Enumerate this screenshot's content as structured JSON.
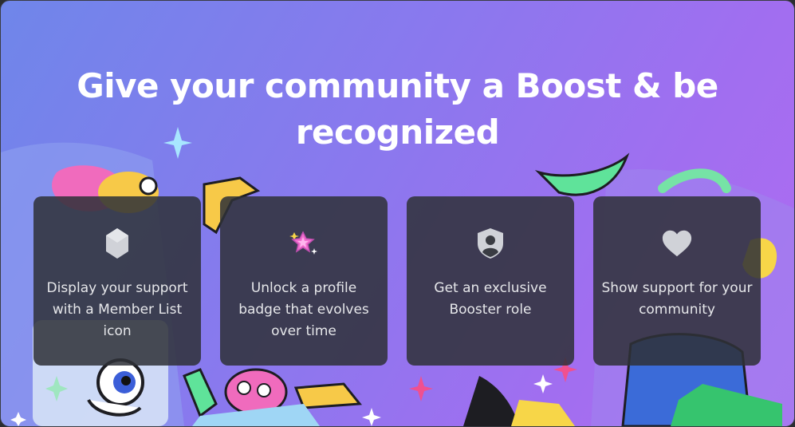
{
  "headline": "Give your community a Boost & be recognized",
  "colors": {
    "gradient_start": "#6f86ea",
    "gradient_end": "#b06bf2",
    "card_bg": "#2f3138",
    "card_text": "#e6e7ea",
    "headline": "#ffffff"
  },
  "perks": [
    {
      "icon": "hexagon-gem-icon",
      "text": "Display your support with a Member List icon"
    },
    {
      "icon": "sparkle-star-badge-icon",
      "text": "Unlock a profile badge that evolves over time"
    },
    {
      "icon": "shield-person-icon",
      "text": "Get an exclusive Booster role"
    },
    {
      "icon": "heart-icon",
      "text": "Show support for your community"
    }
  ]
}
